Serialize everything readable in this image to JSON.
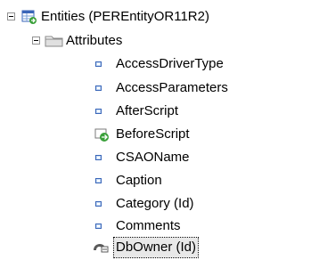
{
  "tree": {
    "root": {
      "label": "Entities (PEREntityOR11R2)",
      "icon": "entity-table-icon"
    },
    "group": {
      "label": "Attributes",
      "icon": "folder-icon"
    },
    "items": [
      {
        "label": "AccessDriverType",
        "icon": "property-icon"
      },
      {
        "label": "AccessParameters",
        "icon": "property-icon"
      },
      {
        "label": "AfterScript",
        "icon": "property-icon"
      },
      {
        "label": "BeforeScript",
        "icon": "script-arrow-icon"
      },
      {
        "label": "CSAOName",
        "icon": "property-icon"
      },
      {
        "label": "Caption",
        "icon": "property-icon"
      },
      {
        "label": "Category (Id)",
        "icon": "property-icon"
      },
      {
        "label": "Comments",
        "icon": "property-icon"
      },
      {
        "label": "DbOwner (Id)",
        "icon": "owner-key-icon",
        "selected": true
      }
    ]
  }
}
